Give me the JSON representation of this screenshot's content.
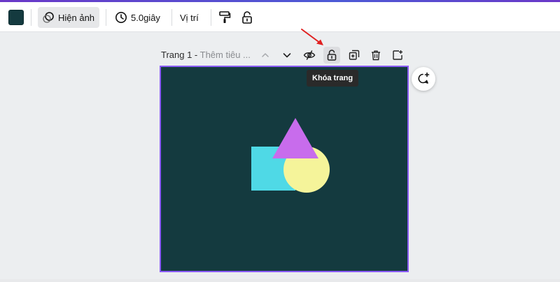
{
  "toolbar": {
    "color_swatch": "#143a3f",
    "show_image_label": "Hiện ảnh",
    "duration_label": "5.0giây",
    "position_label": "Vị trí",
    "icons": [
      "circles-icon",
      "clock-icon",
      "paint-roller-icon",
      "lock-icon"
    ]
  },
  "page_bar": {
    "page_label": "Trang 1 - ",
    "title_placeholder": "Thêm tiêu ...",
    "icons": [
      "chevron-up-icon",
      "chevron-down-icon",
      "eye-hidden-icon",
      "lock-page-icon",
      "duplicate-icon",
      "trash-icon",
      "add-page-icon"
    ]
  },
  "tooltip": {
    "text": "Khóa trang"
  },
  "canvas": {
    "background": "#143a3f",
    "border_color": "#8b5cf6",
    "shapes": [
      {
        "type": "square",
        "color": "#4fd9e6"
      },
      {
        "type": "circle",
        "color": "#f5f49a"
      },
      {
        "type": "triangle",
        "color": "#c86cec"
      }
    ]
  },
  "annotation": {
    "arrow_color": "#e02020"
  }
}
